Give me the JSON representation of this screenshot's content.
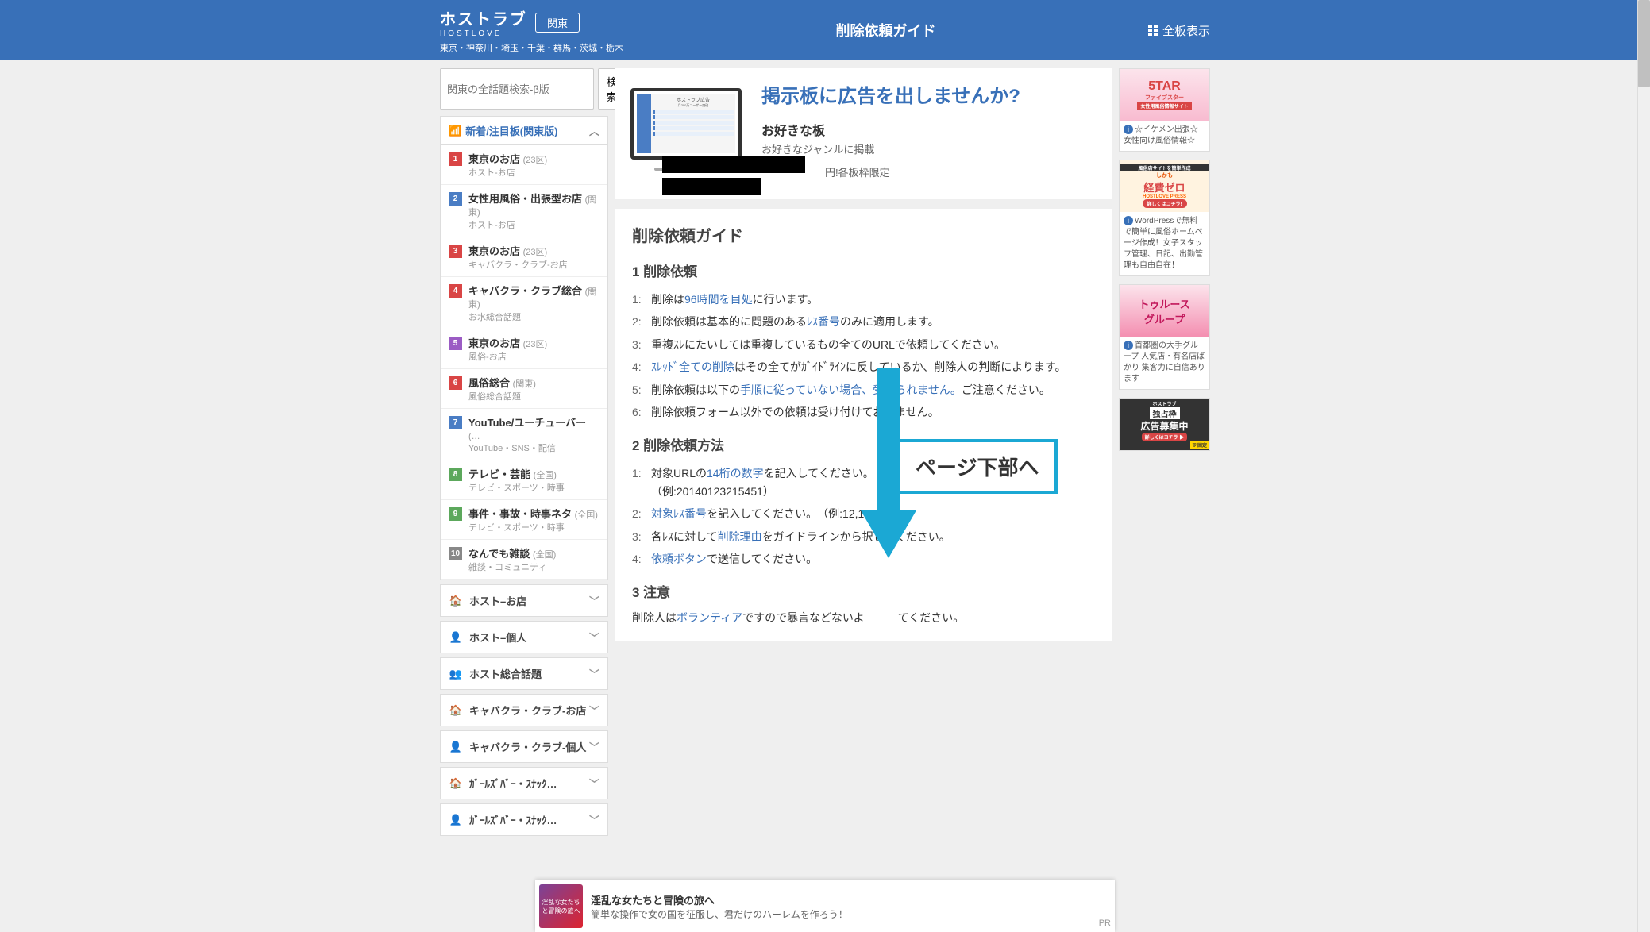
{
  "header": {
    "logo": "ホストラブ",
    "logo_en": "HOSTLOVE",
    "region_button": "関東",
    "regions": "東京・神奈川・埼玉・千葉・群馬・茨城・栃木",
    "page_title": "削除依頼ガイド",
    "all_boards": "全板表示"
  },
  "search": {
    "placeholder": "関東の全話題検索-β版",
    "button": "検索"
  },
  "ranking": {
    "header": "新着/注目板(関東版)",
    "items": [
      {
        "num": "1",
        "title": "東京のお店",
        "region": "(23区)",
        "sub": "ホスト-お店"
      },
      {
        "num": "2",
        "title": "女性用風俗・出張型お店",
        "region": "(関東)",
        "sub": "ホスト-お店"
      },
      {
        "num": "3",
        "title": "東京のお店",
        "region": "(23区)",
        "sub": "キャバクラ・クラブ-お店"
      },
      {
        "num": "4",
        "title": "キャバクラ・クラブ総合",
        "region": "(関東)",
        "sub": "お水総合話題"
      },
      {
        "num": "5",
        "title": "東京のお店",
        "region": "(23区)",
        "sub": "風俗-お店"
      },
      {
        "num": "6",
        "title": "風俗総合",
        "region": "(関東)",
        "sub": "風俗総合話題"
      },
      {
        "num": "7",
        "title": "YouTube/ユーチューバー",
        "region": "(…",
        "sub": "YouTube・SNS・配信"
      },
      {
        "num": "8",
        "title": "テレビ・芸能",
        "region": "(全国)",
        "sub": "テレビ・スポーツ・時事"
      },
      {
        "num": "9",
        "title": "事件・事故・時事ネタ",
        "region": "(全国)",
        "sub": "テレビ・スポーツ・時事"
      },
      {
        "num": "10",
        "title": "なんでも雑談",
        "region": "(全国)",
        "sub": "雑談・コミュニティ"
      }
    ]
  },
  "categories": [
    {
      "icon": "🏠",
      "color": "ic-blue",
      "label": "ホスト–お店"
    },
    {
      "icon": "👤",
      "color": "ic-blue",
      "label": "ホスト–個人"
    },
    {
      "icon": "👥",
      "color": "ic-blue",
      "label": "ホスト総合話題"
    },
    {
      "icon": "🏠",
      "color": "ic-red",
      "label": "キャバクラ・クラブ-お店"
    },
    {
      "icon": "👤",
      "color": "ic-pink",
      "label": "キャバクラ・クラブ-個人"
    },
    {
      "icon": "🏠",
      "color": "ic-red",
      "label": "ｶﾞｰﾙｽﾞﾊﾞｰ・ｽﾅｯｸ…"
    },
    {
      "icon": "👤",
      "color": "ic-pink",
      "label": "ｶﾞｰﾙｽﾞﾊﾞｰ・ｽﾅｯｸ…"
    }
  ],
  "ad_banner": {
    "headline": "掲示板に広告を出しませんか?",
    "sub1_title": "お好きな板",
    "sub1_text": "お好きなジャンルに掲載",
    "sub2_suffix": "円!各板枠限定"
  },
  "content": {
    "h1": "削除依頼ガイド",
    "sec1_title": "1 削除依頼",
    "sec1_items": [
      {
        "pre": "削除は",
        "link": "96時間を目処",
        "post": "に行います。"
      },
      {
        "pre": "削除依頼は基本的に問題のある",
        "link": "ﾚｽ番号",
        "post": "のみに適用します。"
      },
      {
        "text": "重複ｽﾚにたいしては重複しているもの全てのURLで依頼してください。"
      },
      {
        "link": "ｽﾚｯﾄﾞ全ての削除",
        "post": "はその全てがｶﾞｲﾄﾞﾗｲﾝに反しているか、削除人の判断によります。"
      },
      {
        "pre": "削除依頼は以下の",
        "link": "手順に従っていない場合、受付られません。",
        "post": "ご注意ください。"
      },
      {
        "text": "削除依頼フォーム以外での依頼は受け付けておりません。"
      }
    ],
    "sec2_title": "2 削除依頼方法",
    "sec2_items": [
      {
        "pre": "対象URLの",
        "link": "14桁の数字",
        "post": "を記入してください。",
        "example": "（例:20140123215451）"
      },
      {
        "link": "対象ﾚｽ番号",
        "post": "を記入してください。　（例:12,1",
        "post2": "20）"
      },
      {
        "pre": "各ﾚｽに対して",
        "link": "削除理由",
        "post": "をガイドラインから択してください。"
      },
      {
        "link": "依頼ボタン",
        "post": "で送信してください。"
      }
    ],
    "sec3_title": "3 注意",
    "sec3_text_pre": "削除人は",
    "sec3_text_link": "ボランティア",
    "sec3_text_post": "ですので暴言などないよ　　　てください。"
  },
  "arrow_label": "ページ下部へ",
  "right_ads": [
    {
      "img_text1": "5TAR",
      "img_text2": "ファイブスター",
      "img_text3": "女性用風俗情報サイト",
      "caption": "☆イケメン出張☆女性向け風俗情報☆"
    },
    {
      "img_text1": "風俗店サイトを簡単作成",
      "img_text2": "しかも",
      "img_text3": "経費ゼロ",
      "img_text4": "HOSTLOVE PRESS",
      "img_text5": "詳しくはコチラ!",
      "caption": "WordPressで無料で簡単に風俗ホームページ作成！女子スタッフ管理、日記、出勤管理も自由自在！"
    },
    {
      "img_text1": "トゥルース",
      "img_text2": "グループ",
      "caption": "首都圏の大手グループ 人気店・有名店ばかり 集客力に自信あります"
    },
    {
      "img_text1": "ホストラブ",
      "img_text2": "独占枠",
      "img_text3": "広告募集中",
      "img_text4": "詳しくはコチラ ▶",
      "img_text5": "⛨ 固定",
      "caption": ""
    }
  ],
  "bottom_ad": {
    "img_text": "淫乱な女たちと冒険の旅へ",
    "title": "淫乱な女たちと冒険の旅へ",
    "text": "簡単な操作で女の国を征服し、君だけのハーレムを作ろう！",
    "pr": "PR"
  }
}
